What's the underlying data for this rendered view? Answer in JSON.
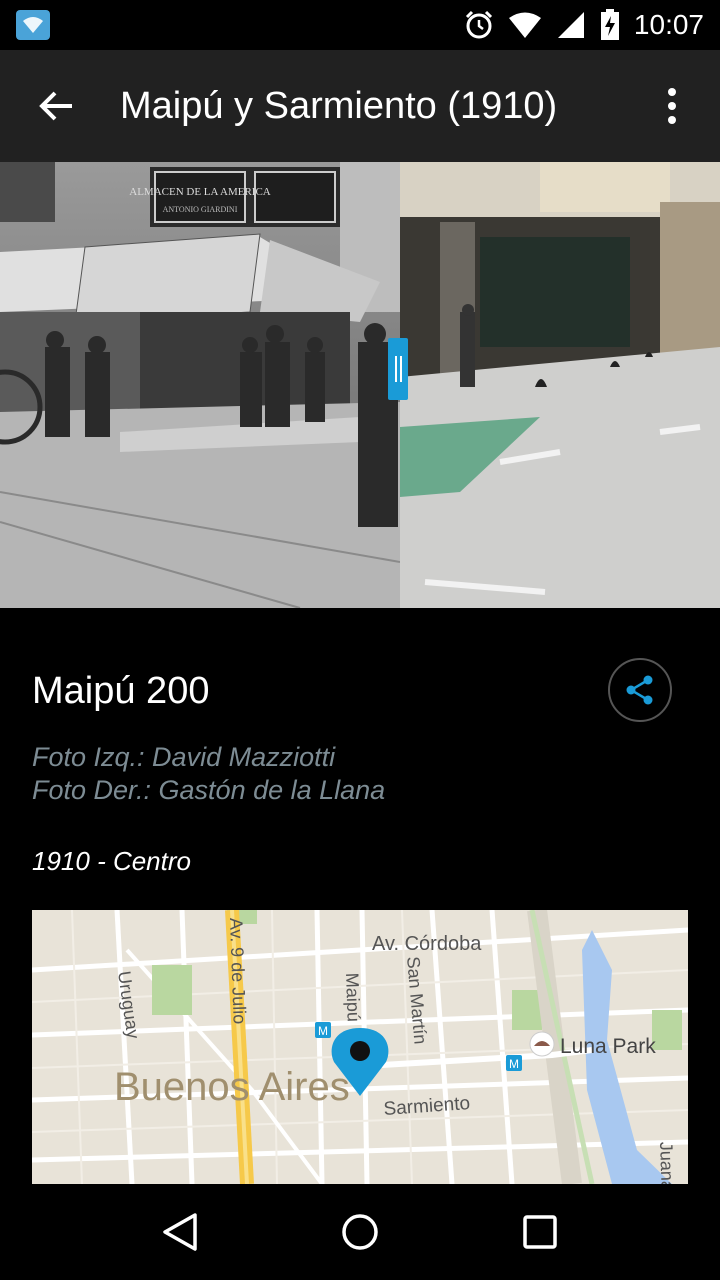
{
  "status_bar": {
    "time": "10:07",
    "icons": [
      "wifi-notification-icon",
      "alarm-icon",
      "wifi-signal-icon",
      "cell-signal-icon",
      "battery-charging-icon"
    ]
  },
  "app_bar": {
    "title": "Maipú y Sarmiento (1910)",
    "back_icon": "arrow-back-icon",
    "menu_icon": "more-vert-icon"
  },
  "photos": {
    "left_sign": "ALMACEN DE LA AMERICA",
    "left_sign_sub": "ANTONIO GIARDINI"
  },
  "detail": {
    "address": "Maipú 200",
    "credit_left": "Foto Izq.: David Mazziotti",
    "credit_right": "Foto Der.: Gastón de la Llana",
    "year_zone": "1910 - Centro",
    "share_icon": "share-icon"
  },
  "map": {
    "city_label": "Buenos Aires",
    "streets": [
      "Av. Córdoba",
      "Av. 9 de Julio",
      "Uruguay",
      "Maipú",
      "San Martín",
      "Sarmiento",
      "Juana"
    ],
    "poi": "Luna Park",
    "accent": "#1a9bd7"
  },
  "nav_bar": {
    "icons": [
      "back-triangle-icon",
      "home-circle-icon",
      "recents-square-icon"
    ]
  },
  "colors": {
    "app_bar": "#212121",
    "accent": "#1a9bd7",
    "credit": "#7d8c94"
  }
}
